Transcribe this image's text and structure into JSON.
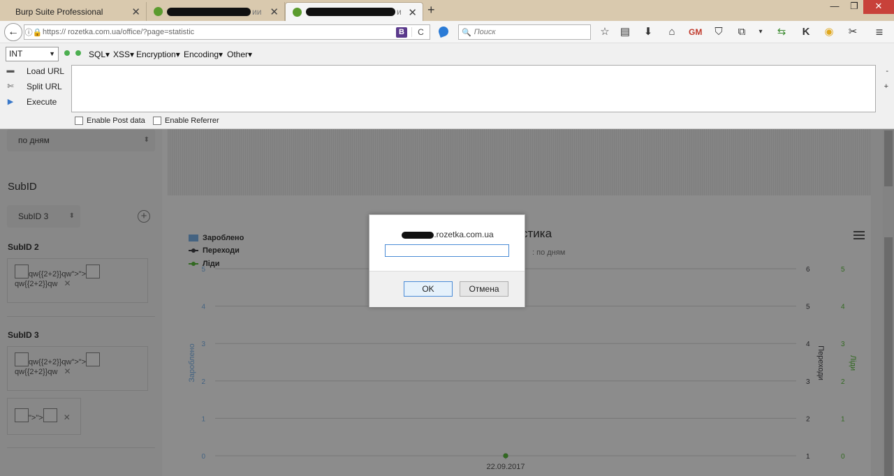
{
  "tabs": [
    {
      "label": "Burp Suite Professional",
      "close": "✕"
    },
    {
      "label": "ии",
      "close": "✕"
    },
    {
      "label": "и",
      "close": "✕"
    }
  ],
  "new_tab": "+",
  "window_controls": {
    "minimize": "—",
    "restore": "❐",
    "close": "✕"
  },
  "nav": {
    "back": "←",
    "url": "https://   rozetka.com.ua/office/?page=statistic",
    "search_placeholder": "Поиск",
    "reload": "C"
  },
  "toolbar_icons": [
    "star-icon",
    "reading-list-icon",
    "download-icon",
    "home-icon",
    "gm-icon",
    "pocket-icon",
    "copy-icon",
    "menu-dropdown-icon",
    "sync-icon",
    "k-icon",
    "chrome-icon",
    "scissors-icon",
    "hamburger-menu-icon"
  ],
  "hackbar": {
    "select_value": "INT",
    "menus": [
      "SQL▾",
      "XSS▾",
      "Encryption▾",
      "Encoding▾",
      "Other▾"
    ],
    "actions": [
      "Load URL",
      "Split URL",
      "Execute"
    ],
    "enable_post": "Enable Post data",
    "enable_referrer": "Enable Referrer",
    "minus": "-",
    "plus": "+"
  },
  "sidebar": {
    "period_select": "по дням",
    "subid_title": "SubID",
    "subid_select": "SubID 3",
    "subid2_heading": "SubID 2",
    "subid2_payload_a": "qw{{2+2}}qw\">\">",
    "subid2_payload_b": "qw{{2+2}}qw",
    "subid3_heading": "SubID 3",
    "subid3_payload_a": "qw{{2+2}}qw\">\">",
    "subid3_payload_b": "qw{{2+2}}qw",
    "extra_payload": "\">\">",
    "remove": "✕"
  },
  "chart": {
    "title": "стика",
    "subtitle": ": по дням",
    "legend": [
      {
        "label": "Зароблено",
        "color": "#7cb5ec"
      },
      {
        "label": "Переходи",
        "color": "#434348"
      },
      {
        "label": "Ліди",
        "color": "#5bbf3c"
      }
    ]
  },
  "chart_data": {
    "type": "line",
    "title": "",
    "x": [
      "22.09.2017"
    ],
    "series": [
      {
        "name": "Зароблено",
        "values": [
          0
        ],
        "axis": "left"
      },
      {
        "name": "Переходи",
        "values": [
          1
        ],
        "axis": "right"
      },
      {
        "name": "Ліди",
        "values": [
          0
        ],
        "axis": "right2"
      }
    ],
    "left_axis": {
      "label": "Зароблено",
      "ticks": [
        "0",
        "1",
        "2",
        "3",
        "4",
        "5"
      ],
      "ylim": [
        0,
        5
      ]
    },
    "right_axis": {
      "label": "Переходи",
      "ticks": [
        "1",
        "2",
        "3",
        "4",
        "5",
        "6"
      ],
      "ylim": [
        1,
        6
      ]
    },
    "right2_axis": {
      "label": "Ліди",
      "ticks": [
        "0",
        "1",
        "2",
        "3",
        "4",
        "5"
      ],
      "ylim": [
        0,
        5
      ]
    },
    "grid": true
  },
  "dialog": {
    "title": ".rozetka.com.ua",
    "input_value": "",
    "ok": "OK",
    "cancel": "Отмена"
  }
}
